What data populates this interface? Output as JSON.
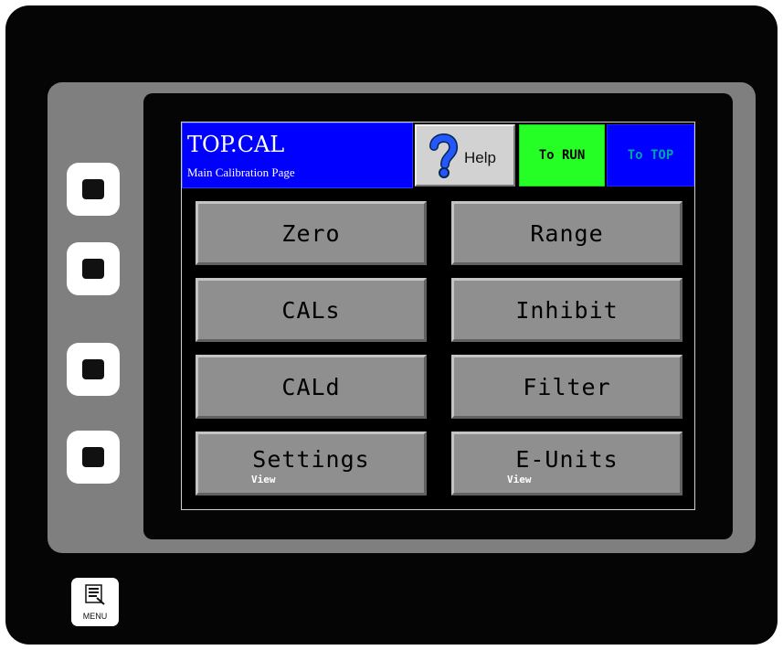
{
  "screen_header": {
    "title": "TOP.CAL",
    "subtitle": "Main Calibration Page",
    "help_label": "Help",
    "to_run_label": "To RUN",
    "to_top_label": "To TOP"
  },
  "buttons": {
    "zero": {
      "label": "Zero"
    },
    "range": {
      "label": "Range"
    },
    "cals": {
      "label": "CALs"
    },
    "inhibit": {
      "label": "Inhibit"
    },
    "cald": {
      "label": "CALd"
    },
    "filter": {
      "label": "Filter"
    },
    "settings": {
      "label": "Settings",
      "sublabel": "View"
    },
    "e_units": {
      "label": "E-Units",
      "sublabel": "View"
    }
  },
  "device": {
    "menu_label": "MENU"
  },
  "colors": {
    "header_blue": "#0000ff",
    "run_green": "#25ff25",
    "button_gray": "#8f8f8f",
    "bezel_gray": "#7f7f7f",
    "device_black": "#050505"
  },
  "icons": {
    "help": "question-mark-icon",
    "menu": "document-list-icon",
    "soft_key": "square-key-icon"
  }
}
